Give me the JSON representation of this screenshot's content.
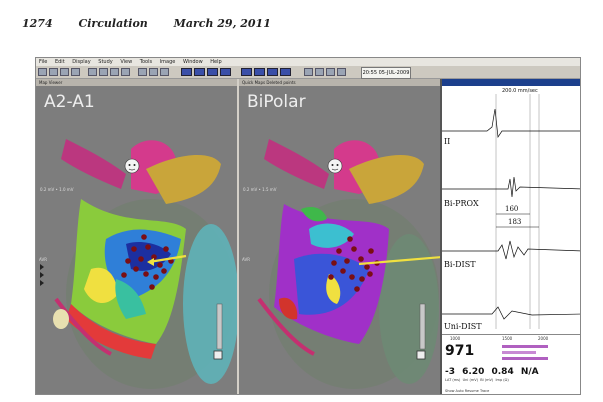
{
  "journal_header": {
    "page": "1274",
    "journal": "Circulation",
    "date": "March 29, 2011"
  },
  "app": {
    "menu": [
      "File",
      "Edit",
      "Display",
      "Study",
      "View",
      "Tools",
      "Image",
      "Window",
      "Help"
    ],
    "clock": "20:55  05-JUL-2009"
  },
  "map_left": {
    "title": "A2-A1",
    "panel_label": "Map Viewer",
    "range_text": "0.2 mV • 1.0 mV",
    "side_label": "AVR"
  },
  "map_right": {
    "title": "BiPolar",
    "panel_label": "Quick  Maps  Deleted points",
    "range_text": "0.2 mV • 1.5 mV",
    "side_label": "AVR"
  },
  "ecg": {
    "speed": "200.0 mm/sec",
    "leads": [
      "II",
      "Bi-PROX",
      "Bi-DIST",
      "Uni-DIST"
    ],
    "intervals": [
      "160",
      "183"
    ],
    "ticks": [
      "1000",
      "1500",
      "2000"
    ]
  },
  "stats": {
    "cycle_length": "971",
    "values": [
      "-3",
      "6.20",
      "0.84",
      "N/A"
    ],
    "labels": [
      "LAT (ms)",
      "Uni (mV)",
      "Bi (mV)",
      "Imp (Ω)"
    ],
    "footer": "Show Auto Resume Trace"
  },
  "colors": {
    "accent": "#1c3f8c",
    "arrow": "#f0e040",
    "point": "#7a0e14",
    "aorta": "#c9a53a",
    "atrium": "#d43a8c",
    "ventricle": "#5fb3b8"
  }
}
